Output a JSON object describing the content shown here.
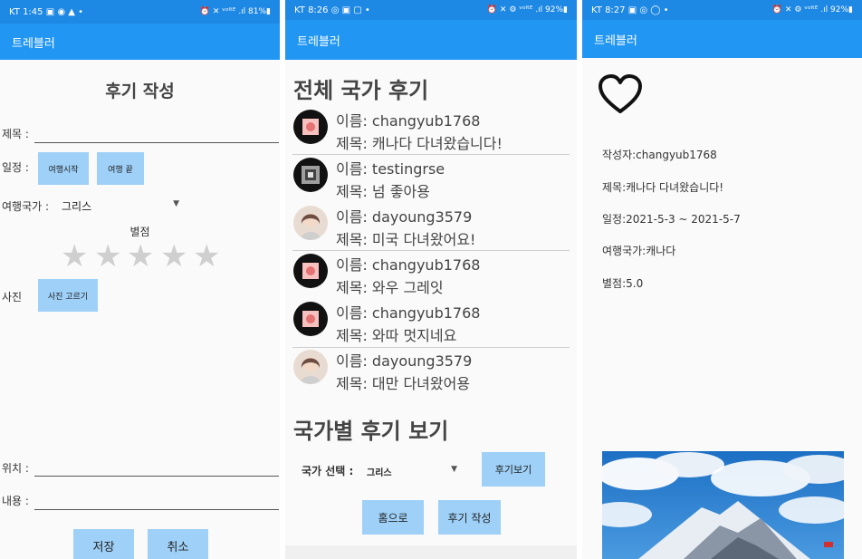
{
  "screen1": {
    "status": {
      "left": "KT 1:45 ▣ ◉ ▲ •",
      "right": "⏰ ✕ ᵛᵒˡᵗᴱ .ıl 81%▮"
    },
    "appbar": {
      "title": "트레블러"
    },
    "heading": "후기 작성",
    "title_label": "제목 :",
    "schedule_label": "일정 :",
    "start_button": "여행시작",
    "end_button": "여행 끝",
    "country_label": "여행국가 :",
    "country_value": "그리스",
    "rating_label": "별점",
    "photo_label": "사진",
    "photo_button": "사진 고르기",
    "location_label": "위치 :",
    "content_label": "내용 :",
    "save_button": "저장",
    "cancel_button": "취소"
  },
  "screen2": {
    "status": {
      "left": "KT 8:26 ◎ ▣ ▢ •",
      "right": "⏰ ✕ ⚙ ᵛᵒˡᵗᴱ .ıl 92%▮"
    },
    "appbar": {
      "title": "트레블러"
    },
    "all_heading": "전체 국가 후기",
    "reviews": [
      {
        "name": "이름: changyub1768",
        "title": "제목: 캐나다 다녀왔습니다!",
        "avatar": "red"
      },
      {
        "name": "이름: testingrse",
        "title": "제목: 넘 좋아용",
        "avatar": "grey"
      },
      {
        "name": "이름: dayoung3579",
        "title": "제목: 미국 다녀왔어요!",
        "avatar": "person"
      },
      {
        "name": "이름: changyub1768",
        "title": "제목: 와우 그레잇",
        "avatar": "red"
      },
      {
        "name": "이름: changyub1768",
        "title": "제목: 와따 멋지네요",
        "avatar": "red"
      },
      {
        "name": "이름: dayoung3579",
        "title": "제목: 대만 다녀왔어용",
        "avatar": "person"
      }
    ],
    "country_heading": "국가별 후기 보기",
    "select_label": "국가 선택 :",
    "select_value": "그리스",
    "view_button": "후기보기",
    "home_button": "홈으로",
    "write_button": "후기 작성"
  },
  "screen3": {
    "status": {
      "left": "KT 8:27 ▣ ◎ ◯ •",
      "right": "⏰ ✕ ⚙ ᵛᵒˡᵗᴱ .ıl 92%▮"
    },
    "appbar": {
      "title": "트레블러"
    },
    "author": "작성자:changyub1768",
    "title": "제목:캐나다 다녀왔습니다!",
    "schedule": "일정:2021-5-3 ~ 2021-5-7",
    "country": "여행국가:캐나다",
    "rating": "별점:5.0"
  },
  "colors": {
    "appbar": "#2196f3",
    "button": "#9ed0f8",
    "star": "#cfcfcf"
  }
}
